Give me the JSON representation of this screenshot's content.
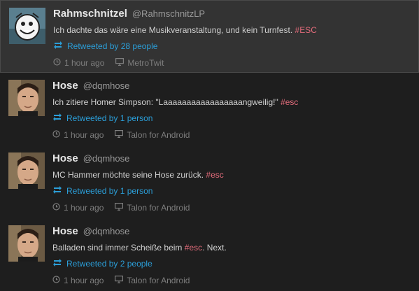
{
  "tweets": [
    {
      "name": "Rahmschnitzel",
      "handle": "@RahmschnitzLP",
      "text": "Ich dachte das wäre eine Musikveranstaltung, und kein Turnfest.",
      "hashtag": "#ESC",
      "text_after": "",
      "retweeted": "Retweeted by 28 people",
      "time": "1 hour ago",
      "client": "MetroTwit",
      "avatar": "cartoon-avatar"
    },
    {
      "name": "Hose",
      "handle": "@dqmhose",
      "text": "Ich zitiere Homer Simpson: \"Laaaaaaaaaaaaaaaaangweilig!\"",
      "hashtag": "#esc",
      "text_after": "",
      "retweeted": "Retweeted by 1 person",
      "time": "1 hour ago",
      "client": "Talon for Android",
      "avatar": "photo-avatar"
    },
    {
      "name": "Hose",
      "handle": "@dqmhose",
      "text": "MC Hammer möchte seine Hose zurück.",
      "hashtag": "#esc",
      "text_after": "",
      "retweeted": "Retweeted by 1 person",
      "time": "1 hour ago",
      "client": "Talon for Android",
      "avatar": "photo-avatar"
    },
    {
      "name": "Hose",
      "handle": "@dqmhose",
      "text": "Balladen sind immer Scheiße beim",
      "hashtag": "#esc",
      "text_after": ". Next.",
      "retweeted": "Retweeted by 2 people",
      "time": "1 hour ago",
      "client": "Talon for Android",
      "avatar": "photo-avatar"
    }
  ],
  "colors": {
    "retweet": "#2b9ed8",
    "hashtag": "#e06b7a",
    "background": "#1e1e1e",
    "highlight": "#333333"
  },
  "icons": {
    "retweet": "retweet-icon",
    "time": "clock-icon",
    "client": "monitor-icon"
  }
}
